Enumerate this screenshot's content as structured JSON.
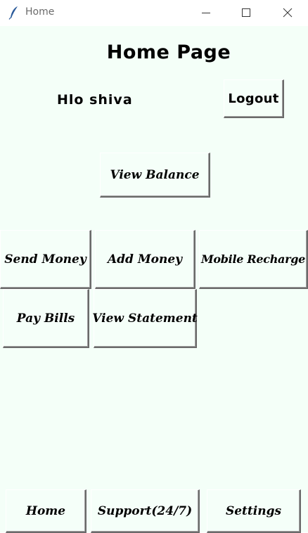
{
  "window": {
    "title": "Home",
    "icon": "feather-icon",
    "controls": [
      "minimize-icon",
      "maximize-icon",
      "close-icon"
    ]
  },
  "header": {
    "title": "Home Page",
    "greeting": "Hlo shiva",
    "logout_label": "Logout"
  },
  "actions": {
    "view_balance": "View Balance",
    "send_money": "Send Money",
    "add_money": "Add Money",
    "mobile_recharge": "Mobile Recharge",
    "pay_bills": "Pay Bills",
    "view_statement": "View Statement"
  },
  "footer": {
    "home": "Home",
    "support": "Support(24/7)",
    "settings": "Settings"
  },
  "colors": {
    "background": "#f4fff8",
    "button_face": "#f5fff9",
    "text": "#000000"
  }
}
